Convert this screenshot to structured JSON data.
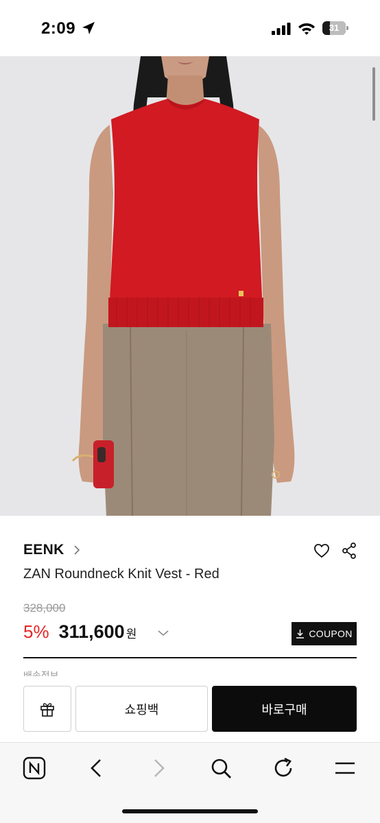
{
  "status_bar": {
    "time": "2:09",
    "battery_level": "31",
    "battery_fraction": 0.31
  },
  "product": {
    "brand": "EENK",
    "title": "ZAN Roundneck Knit Vest - Red",
    "original_price": "328,000",
    "discount": "5%",
    "sale_price": "311,600",
    "currency": "원",
    "coupon_label": "COUPON",
    "clipped_text": "배송정보",
    "colors": {
      "vest": "#d11a22",
      "discount": "#e52727",
      "trousers": "#9c8a78"
    }
  },
  "actions": {
    "cart_label": "쇼핑백",
    "buy_label": "바로구매"
  },
  "browser": {
    "icons": [
      "naver-home-icon",
      "back-icon",
      "forward-icon",
      "search-icon",
      "reload-icon",
      "menu-icon"
    ]
  }
}
